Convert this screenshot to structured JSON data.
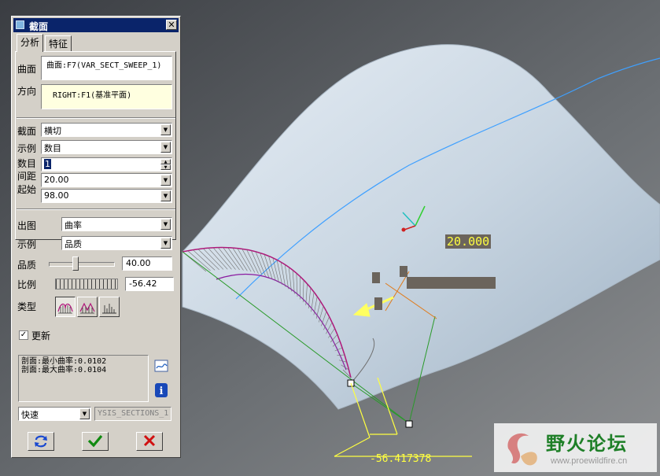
{
  "dialog": {
    "title": "截面",
    "tabs": [
      "分析",
      "特征"
    ],
    "surface_label": "曲面",
    "surface_value": "曲面:F7(VAR_SECT_SWEEP_1)",
    "direction_label": "方向",
    "direction_value": "RIGHT:F1(基准平面)",
    "section_label": "截面",
    "section_value": "横切",
    "example_label": "示例",
    "example_value": "数目",
    "count_label": "数目",
    "count_value": "1",
    "spacing_label": "间距",
    "spacing_value": "20.00",
    "start_label": "起始",
    "start_value": "98.00",
    "plot_label": "出图",
    "plot_value": "曲率",
    "example2_label": "示例",
    "example2_value": "品质",
    "quality_label": "品质",
    "quality_value": "40.00",
    "quality_level": 0.4,
    "scale_label": "比例",
    "scale_value": "-56.42",
    "type_label": "类型",
    "update_label": "更新",
    "update_checked": true,
    "result_lines": [
      "剖面:最小曲率:0.0102",
      "剖面:最大曲率:0.0104"
    ],
    "mode_value": "快速",
    "name_value": "YSIS_SECTIONS_1"
  },
  "viewport": {
    "dimension_value": "20.000",
    "scale_dim_value": "-56.417378",
    "highlight_color": "#ffff40",
    "curve_color": "#3fa0ff",
    "comb_color": "#b0157a"
  },
  "watermark": {
    "title": "野火论坛",
    "url": "www.proewildfire.cn"
  }
}
